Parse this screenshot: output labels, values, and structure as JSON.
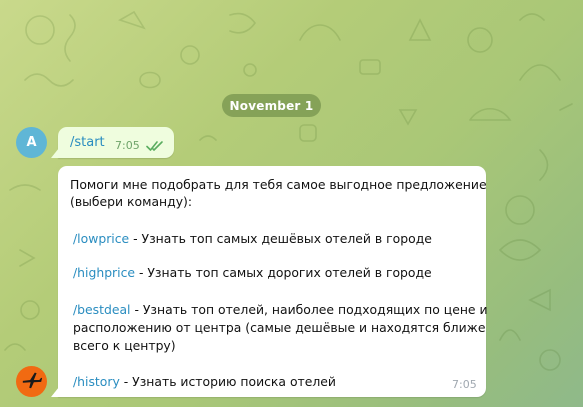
{
  "chat": {
    "date_divider": "November 1",
    "user_avatar_letter": "A",
    "outgoing_message": {
      "text": "/start",
      "time": "7:05",
      "status_icon": "double-check-icon"
    },
    "incoming_message": {
      "intro_line1": "Помоги мне подобрать для тебя самое выгодное предложение",
      "intro_line2": "(выбери команду):",
      "commands": [
        {
          "command": "/lowprice",
          "description": " - Узнать топ самых дешёвых отелей в городе"
        },
        {
          "command": "/highprice",
          "description": " - Узнать топ самых дорогих отелей в городе"
        },
        {
          "command": "/bestdeal",
          "description": " - Узнать топ отелей, наиболее подходящих по цене и",
          "continuation": [
            "расположению от центра (самые дешёвые и находятся ближе",
            "всего к центру)"
          ]
        },
        {
          "command": "/history",
          "description": " - Узнать историю поиска отелей"
        }
      ],
      "time": "7:05"
    },
    "bot_avatar_icon": "airplane-icon"
  },
  "colors": {
    "accent_link": "#2a8dc0",
    "outgoing_bubble": "#effdde",
    "incoming_bubble": "#ffffff",
    "bot_avatar": "#f16a12",
    "user_avatar": "#5fb6d6"
  }
}
